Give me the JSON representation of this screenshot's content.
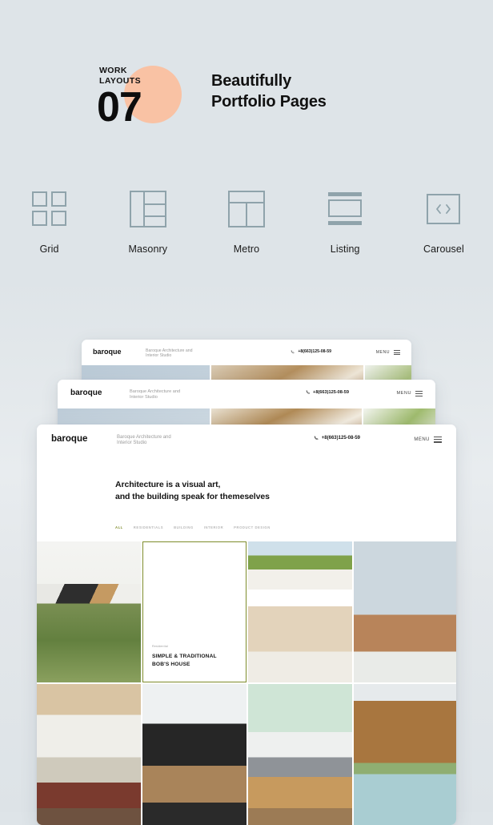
{
  "hero": {
    "kicker": "WORK\nLAYOUTS",
    "number": "07",
    "title": "Beautifully\nPortfolio Pages"
  },
  "layouts": [
    {
      "label": "Grid",
      "icon": "grid-icon"
    },
    {
      "label": "Masonry",
      "icon": "masonry-icon"
    },
    {
      "label": "Metro",
      "icon": "metro-icon"
    },
    {
      "label": "Listing",
      "icon": "listing-icon"
    },
    {
      "label": "Carousel",
      "icon": "carousel-icon"
    }
  ],
  "site": {
    "logo": "baroque",
    "tagline": "Baroque Architecture and\nInterior Studio",
    "phone": "+8(663)125-08-59",
    "phone_icon": "phone-icon",
    "menu_label": "MENU",
    "menu_icon": "hamburger-icon"
  },
  "front": {
    "headline": "Architecture is a visual art,\nand the building speak for themeselves",
    "filters": [
      {
        "label": "ALL",
        "active": true
      },
      {
        "label": "RESIDENTIALS",
        "active": false
      },
      {
        "label": "BUILDING",
        "active": false
      },
      {
        "label": "INTERIOR",
        "active": false
      },
      {
        "label": "PRODUCT DESIGN",
        "active": false
      }
    ],
    "card": {
      "kicker": "Residential",
      "title": "SIMPLE & TRADITIONAL\nBOB'S HOUSE"
    }
  },
  "colors": {
    "background": "#dee4e8",
    "accent_peach": "#f9c2a4",
    "icon_stroke": "#8fa3ab",
    "filter_active": "#7e8c2b",
    "text": "#111111"
  }
}
